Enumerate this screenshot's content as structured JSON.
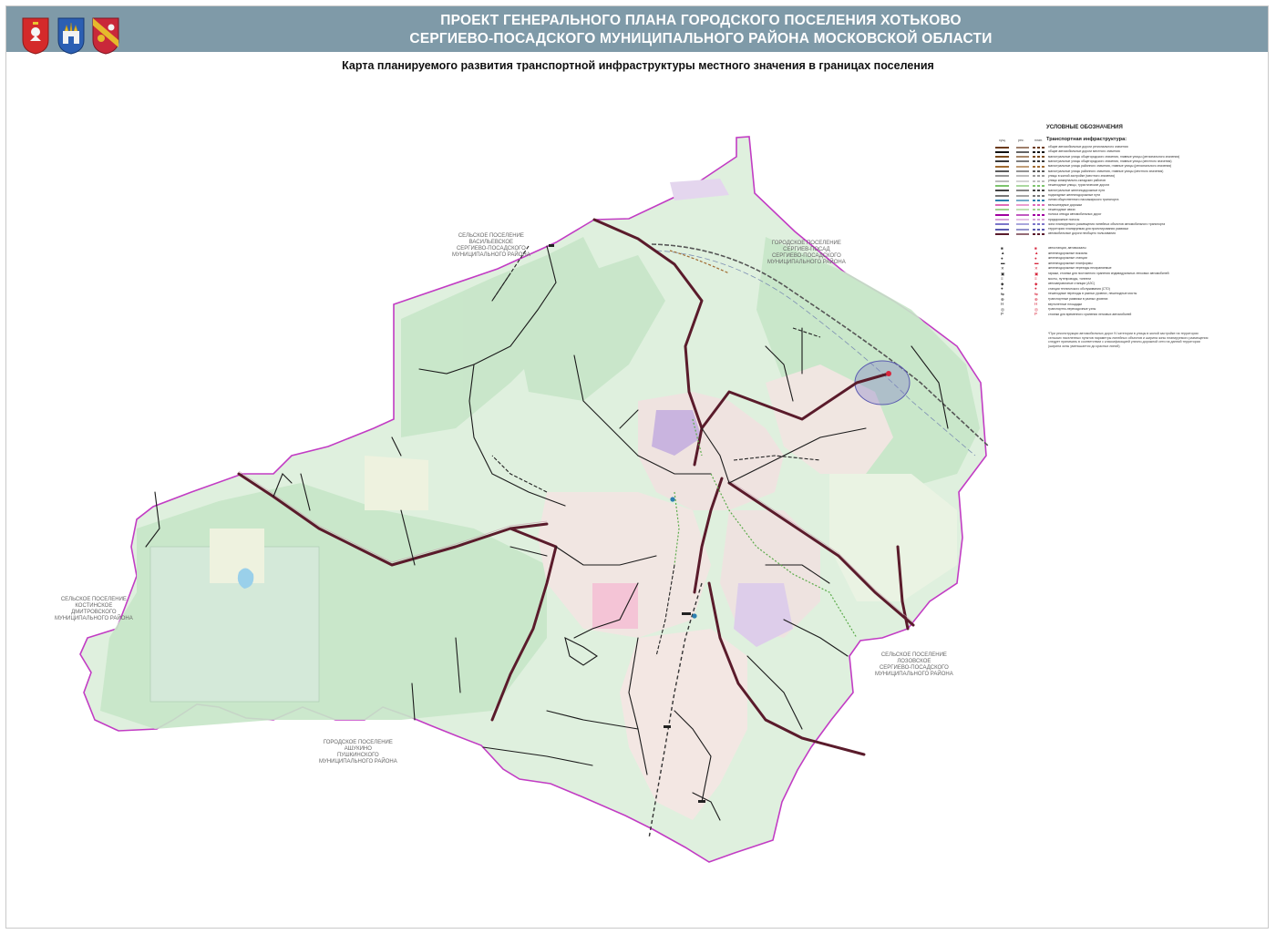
{
  "header": {
    "title_line1": "ПРОЕКТ ГЕНЕРАЛЬНОГО ПЛАНА ГОРОДСКОГО ПОСЕЛЕНИЯ ХОТЬКОВО",
    "title_line2": "СЕРГИЕВО-ПОСАДСКОГО МУНИЦИПАЛЬНОГО РАЙОНА МОСКОВСКОЙ ОБЛАСТИ",
    "emblems": [
      "moscow-oblast-coat-of-arms",
      "sergiev-posad-district-coat-of-arms",
      "khotkovo-coat-of-arms"
    ]
  },
  "map": {
    "title": "Карта планируемого развития транспортной инфраструктуры местного значения в границах поселения",
    "neighbors": [
      {
        "line1": "СЕЛЬСКОЕ ПОСЕЛЕНИЕ",
        "line2": "ВАСИЛЬЕВСКОЕ",
        "line3": "СЕРГИЕВО-ПОСАДСКОГО",
        "line4": "МУНИЦИПАЛЬНОГО РАЙОНА"
      },
      {
        "line1": "ГОРОДСКОЕ ПОСЕЛЕНИЕ",
        "line2": "СЕРГИЕВ-ПОСАД",
        "line3": "СЕРГИЕВО-ПОСАДСКОГО",
        "line4": "МУНИЦИПАЛЬНОГО РАЙОНА"
      },
      {
        "line1": "СЕЛЬСКОЕ ПОСЕЛЕНИЕ",
        "line2": "КОСТИНСКОЕ",
        "line3": "ДМИТРОВСКОГО",
        "line4": "МУНИЦИПАЛЬНОГО РАЙОНА"
      },
      {
        "line1": "СЕЛЬСКОЕ ПОСЕЛЕНИЕ",
        "line2": "ЛОЗОВСКОЕ",
        "line3": "СЕРГИЕВО-ПОСАДСКОГО",
        "line4": "МУНИЦИПАЛЬНОГО РАЙОНА"
      },
      {
        "line1": "ГОРОДСКОЕ ПОСЕЛЕНИЕ",
        "line2": "АШУКИНО",
        "line3": "ПУШКИНСКОГО",
        "line4": "МУНИЦИПАЛЬНОГО РАЙОНА"
      }
    ],
    "colors": {
      "boundary": "#c23cc4",
      "territory": "#dcefdc",
      "forest": "#c4e4c6",
      "urban": "#f0e2dc",
      "main_road": "#5a1b2b",
      "local_road": "#1a1a1a",
      "railway": "#555555",
      "planned_district": "#b28ad0"
    }
  },
  "legend": {
    "title": "УСЛОВНЫЕ ОБОЗНАЧЕНИЯ",
    "col_headers": [
      "сущ.",
      "рек.",
      "план."
    ],
    "section": "Транспортная инфраструктура:",
    "items": [
      {
        "color": "#6b3a1c",
        "label": "общие автомобильные дороги регионального значения"
      },
      {
        "color": "#111111",
        "label": "общие автомобильные дороги местного значения"
      },
      {
        "color": "#7a4a1c",
        "label": "магистральные улицы общегородского значения, главные улицы (регионального значения)"
      },
      {
        "color": "#3a3a3a",
        "label": "магистральные улицы общегородского значения, главные улицы (местного значения)"
      },
      {
        "color": "#a06a30",
        "label": "магистральные улицы районного значения, главные улицы (регионального значения)"
      },
      {
        "color": "#5c5c5c",
        "label": "магистральные улицы районного значения, главные улицы (местного значения)"
      },
      {
        "color": "#999999",
        "label": "улицы в жилой застройке (местного значения)"
      },
      {
        "color": "#bbbbbb",
        "label": "улицы коммунально-складских районов"
      },
      {
        "color": "#7cc46c",
        "label": "пешеходные улицы, туристические дороги"
      },
      {
        "color": "#444444",
        "label": "магистральные железнодорожные пути"
      },
      {
        "color": "#777777",
        "label": "подъездные железнодорожные пути"
      },
      {
        "color": "#2d7fb0",
        "label": "линии общественного пассажирского транспорта"
      },
      {
        "color": "#e06ab8",
        "label": "велосипедные дорожки"
      },
      {
        "color": "#9fd08c",
        "label": "пешеходные связи"
      },
      {
        "color": "#a000a0",
        "label": "полоса отвода автомобильных дорог"
      },
      {
        "color": "#d8a0d8",
        "label": "придорожные полосы"
      },
      {
        "color": "#7b76c9",
        "label": "зона планируемого размещения линейных объектов автомобильного транспорта"
      },
      {
        "color": "#5a5ab0",
        "label": "территория планируемая для проектирования развязки"
      },
      {
        "color": "#5a1b2b",
        "label": "автомобильные дороги необщего пользования"
      }
    ],
    "points": [
      {
        "label": "автостанции, автовокзалы"
      },
      {
        "label": "железнодорожные вокзалы"
      },
      {
        "label": "железнодорожные станции"
      },
      {
        "label": "железнодорожные платформы"
      },
      {
        "label": "железнодорожные переезды неохраняемые"
      },
      {
        "label": "гаражи, стоянки для постоянного хранения индивидуальных легковых автомобилей"
      },
      {
        "label": "мосты, путепроводы, тоннели"
      },
      {
        "label": "автозаправочные станции (АЗС)"
      },
      {
        "label": "станции технического обслуживания (СТО)"
      },
      {
        "label": "пешеходные переходы в разных уровнях, пешеходные мосты"
      },
      {
        "label": "транспортные развязки в разных уровнях"
      },
      {
        "label": "вертолетные площадки"
      },
      {
        "label": "транспортно-пересадочные узлы"
      },
      {
        "label": "стоянки для временного хранения легковых автомобилей"
      }
    ],
    "note": "*При реконструкции автомобильных дорог IV категории в улицы в жилой застройке на территории сельских населенных пунктов параметры линейных объектов и ширина зоны планируемого размещения следует принимать в соответствии с классификацией улично-дорожной сети на данной территории (ширина зоны уменьшается до красных линий)"
  }
}
